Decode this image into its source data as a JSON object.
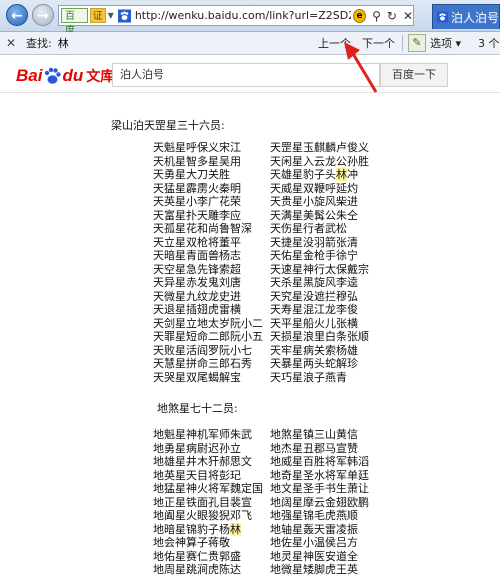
{
  "browser": {
    "nav_back_glyph": "←",
    "nav_forward_glyph": "→",
    "site_badge": "百度",
    "cert_badge": "证",
    "url": "http://wenku.baidu.com/link?url=Z2SD2AGloD",
    "tab_title": "泊人泊号",
    "compat_glyph": "e",
    "search_glyph": "⚲",
    "refresh_glyph": "↻",
    "close_glyph": "✕"
  },
  "findbar": {
    "close_glyph": "✕",
    "label": "查找:",
    "term": "林",
    "prev_label": "上一个",
    "next_label": "下一个",
    "options_label": "选项 ▾",
    "count_label": "3 个"
  },
  "baidu": {
    "logo_bai": "Bai",
    "logo_du": "du",
    "logo_wenku": "文库",
    "search_value": "泊人泊号",
    "search_button": "百度一下"
  },
  "document": {
    "tiangang_heading": "梁山泊天罡星三十六员:",
    "tiangang_left": [
      "天魁星呼保义宋江",
      "天机星智多星吴用",
      "天勇星大刀关胜",
      "天猛星霹雳火秦明",
      "天英星小李广花荣",
      "天富星扑天雕李应",
      "天孤星花和尚鲁智深",
      "天立星双枪将董平",
      "天暗星青面兽杨志",
      "天空星急先锋索超",
      "天异星赤发鬼刘唐",
      "天微星九纹龙史进",
      "天退星插翅虎雷横",
      "天剑星立地太岁阮小二",
      "天罪星短命二郎阮小五",
      "天败星活阎罗阮小七",
      "天慧星拼命三郎石秀",
      "天哭星双尾蝎解宝"
    ],
    "tiangang_right": [
      "天罡星玉麒麟卢俊义",
      "天闲星入云龙公孙胜",
      "天雄星豹子头",
      "天威星双鞭呼延灼",
      "天贵星小旋风柴进",
      "天满星美髯公朱仝",
      "天伤星行者武松",
      "天捷星没羽箭张清",
      "天佑星金枪手徐宁",
      "天速星神行太保戴宗",
      "天杀星黑旋风李逵",
      "天究星没遮拦穆弘",
      "天寿星混江龙李俊",
      "天平星船火儿张横",
      "天损星浪里白条张顺",
      "天牢星病关索杨雄",
      "天暴星两头蛇解珍",
      "天巧星浪子燕青"
    ],
    "tiangang_right_3_highlight": "林",
    "tiangang_right_3_tail": "冲",
    "disha_heading": "地煞星七十二员:",
    "disha_left": [
      "地魁星神机军师朱武",
      "地勇星病尉迟孙立",
      "地雄星井木犴郝思文",
      "地英星天目将彭玘",
      "地猛星神火将军魏定国",
      "地正星铁面孔目裴宣",
      "地阖星火眼狻猊邓飞",
      "地暗星锦豹子杨",
      "地会神算子蒋敬",
      "地佑星赛仁贵郭盛",
      "地周星跳涧虎陈达"
    ],
    "disha_left_8_highlight": "林",
    "disha_right": [
      "地煞星镇三山黄信",
      "地杰星丑郡马宣赞",
      "地威星百胜将军韩滔",
      "地奇星圣水将军单廷",
      "地文星圣手书生萧让",
      "地阔星摩云金翅欧鹏",
      "地强星锦毛虎燕顺",
      "地轴星轰天雷凌振",
      "地佐星小温侯吕方",
      "地灵星神医安道全",
      "地微星矮脚虎王英"
    ]
  }
}
